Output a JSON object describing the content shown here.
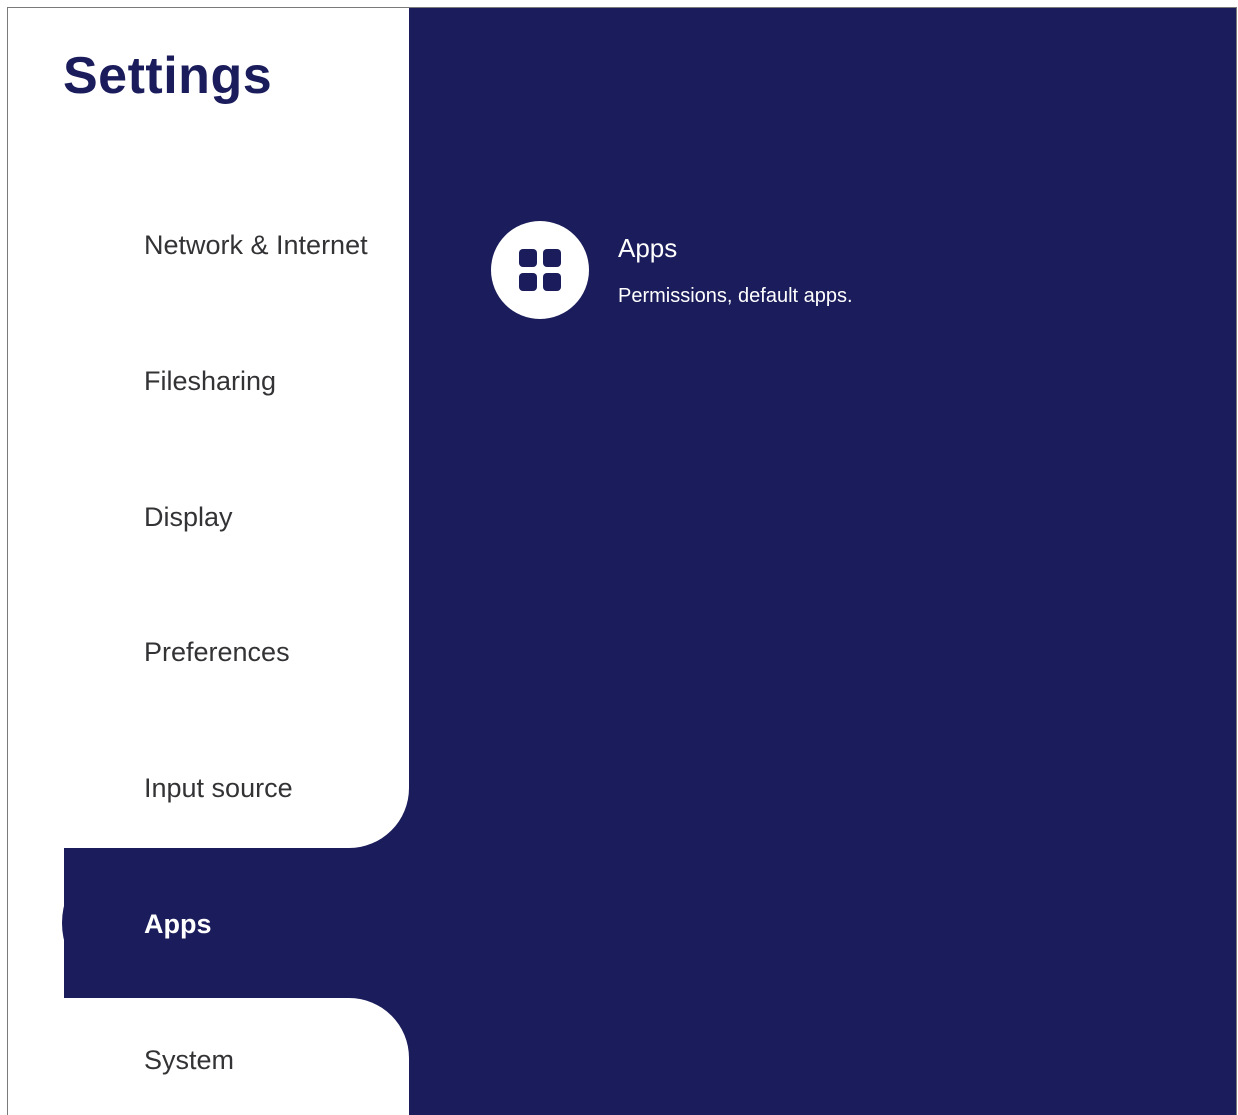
{
  "app": {
    "title": "Settings"
  },
  "sidebar": {
    "items": [
      {
        "label": "Network & Internet"
      },
      {
        "label": "Filesharing"
      },
      {
        "label": "Display"
      },
      {
        "label": "Preferences"
      },
      {
        "label": "Input source"
      },
      {
        "label": "Apps",
        "selected": true
      },
      {
        "label": "System"
      }
    ]
  },
  "main": {
    "entries": [
      {
        "title": "Apps",
        "subtitle": "Permissions, default apps.",
        "icon": "apps-grid-icon"
      }
    ]
  },
  "colors": {
    "primary": "#1b1c5b",
    "sidebar_bg": "#ffffff",
    "nav_text": "#333336",
    "content_text": "#ffffff"
  }
}
